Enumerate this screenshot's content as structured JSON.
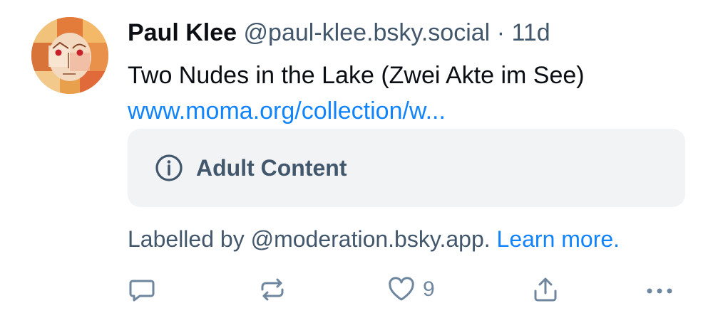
{
  "post": {
    "author": {
      "display_name": "Paul Klee",
      "handle": "@paul-klee.bsky.social",
      "separator": "·",
      "time": "11d"
    },
    "text": "Two Nudes in the Lake (Zwei Akte im See)",
    "link_text": "www.moma.org/collection/w...",
    "content_warning": {
      "icon": "info-circle-icon",
      "label": "Adult Content"
    },
    "moderation_note": {
      "text": "Labelled by @moderation.bsky.app.",
      "learn_more": "Learn more."
    },
    "actions": {
      "reply_icon": "speech-bubble-icon",
      "repost_icon": "repost-arrows-icon",
      "like_icon": "heart-icon",
      "like_count": "9",
      "share_icon": "share-upload-icon",
      "more_icon": "ellipsis-icon"
    }
  },
  "colors": {
    "link": "#1083fe",
    "muted_text": "#42576c",
    "action_icon": "#6f869f",
    "warning_bg": "#f1f3f5"
  }
}
